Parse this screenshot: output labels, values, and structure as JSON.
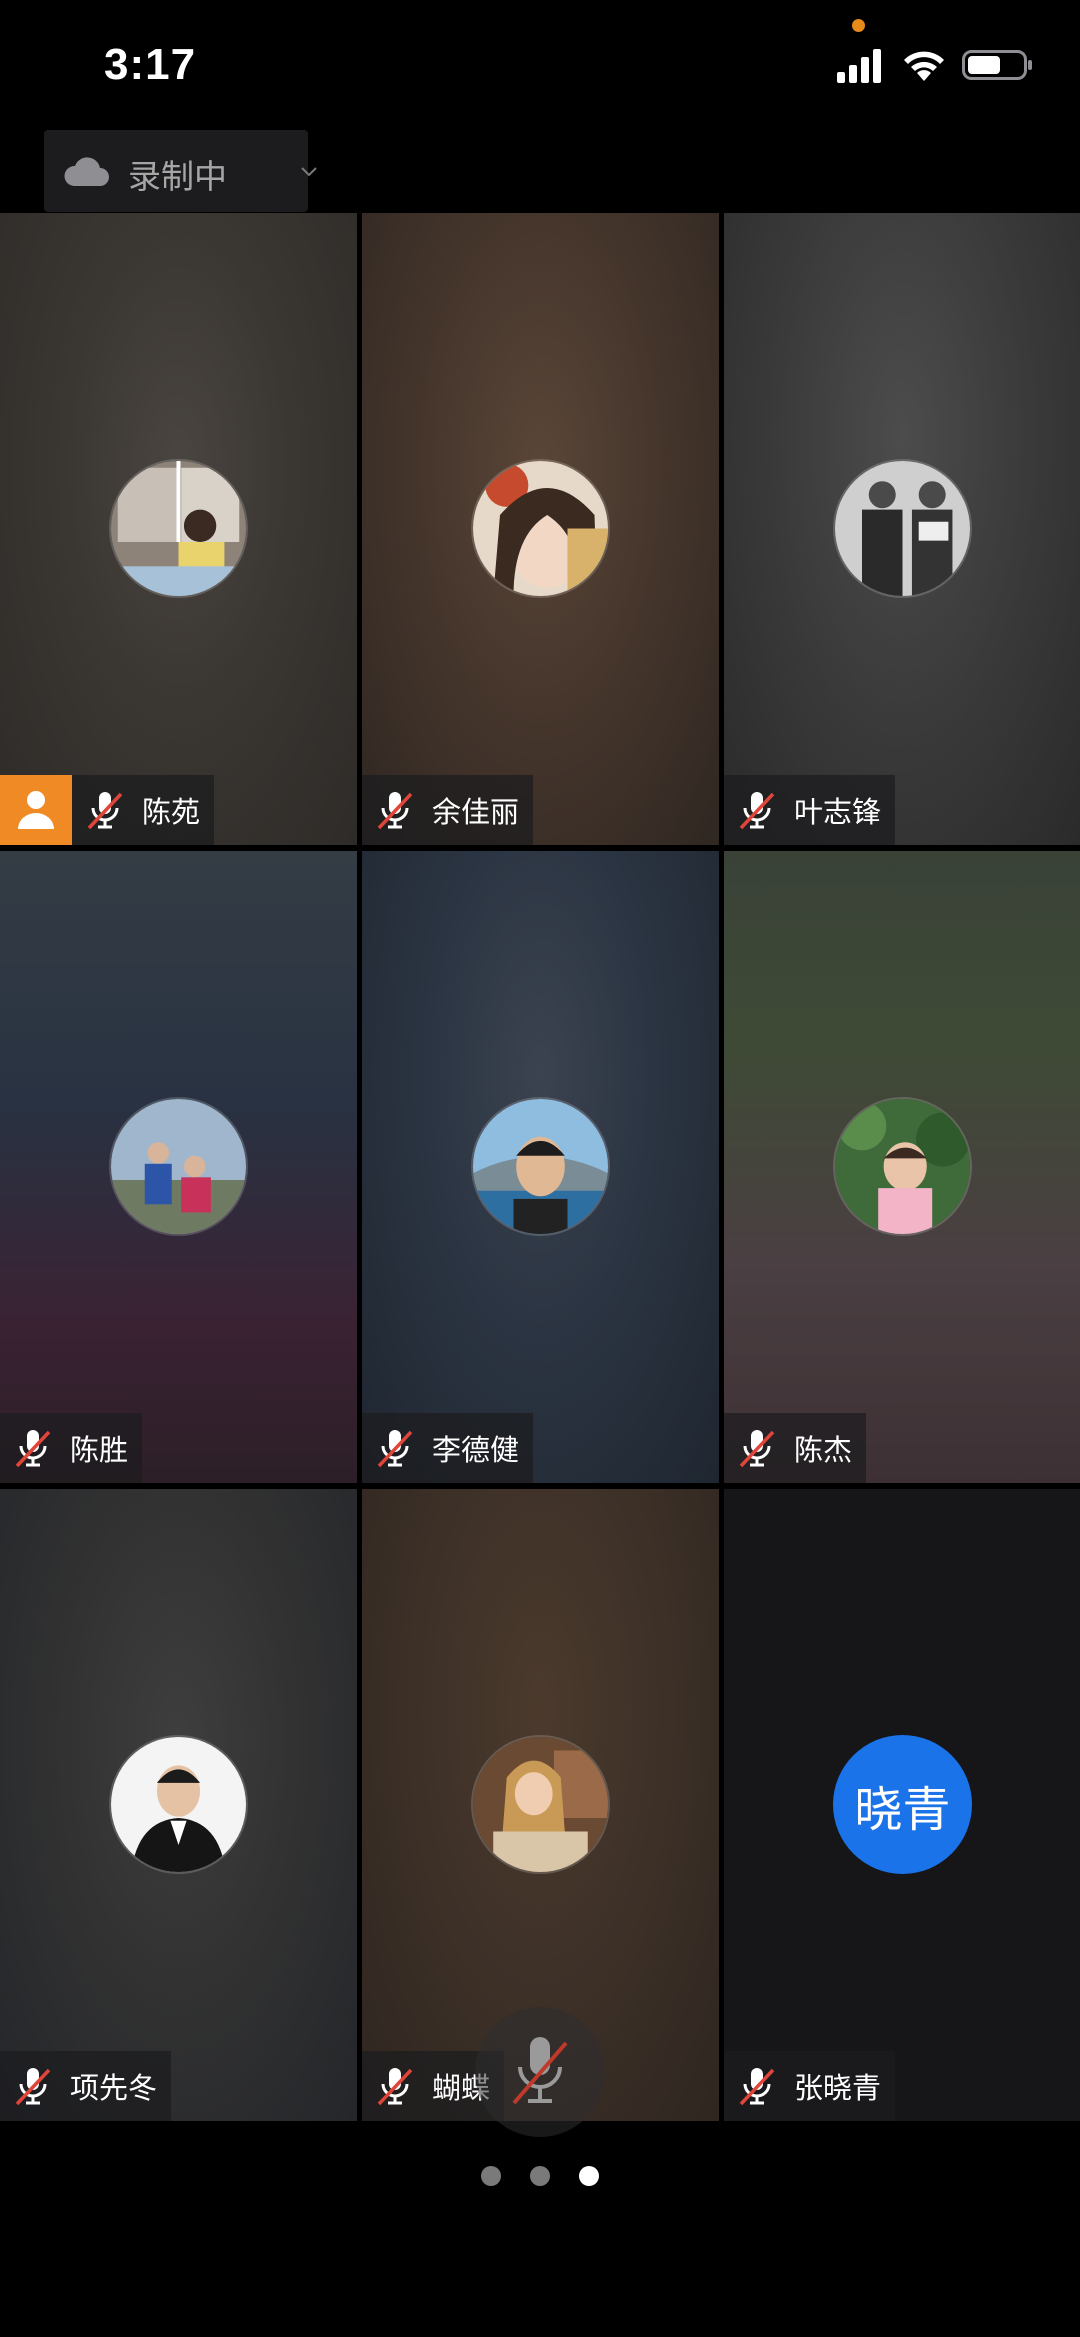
{
  "status_bar": {
    "time": "3:17",
    "signal_icon": "cellular-signal-icon",
    "wifi_icon": "wifi-icon",
    "battery_icon": "battery-icon",
    "recording_indicator_color": "#e68a1a"
  },
  "recording": {
    "label": "录制中",
    "icon": "cloud-icon",
    "dropdown_icon": "chevron-down-icon"
  },
  "participants": [
    {
      "name": "陈苑",
      "muted": true,
      "is_host": true,
      "avatar": "photo"
    },
    {
      "name": "余佳丽",
      "muted": true,
      "is_host": false,
      "avatar": "photo"
    },
    {
      "name": "叶志锋",
      "muted": true,
      "is_host": false,
      "avatar": "photo"
    },
    {
      "name": "陈胜",
      "muted": true,
      "is_host": false,
      "avatar": "photo"
    },
    {
      "name": "李德健",
      "muted": true,
      "is_host": false,
      "avatar": "photo"
    },
    {
      "name": "陈杰",
      "muted": true,
      "is_host": false,
      "avatar": "photo"
    },
    {
      "name": "项先冬",
      "muted": true,
      "is_host": false,
      "avatar": "photo"
    },
    {
      "name": "蝴蝶",
      "muted": true,
      "is_host": false,
      "avatar": "photo"
    },
    {
      "name": "张晓青",
      "muted": true,
      "is_host": false,
      "avatar": "initials",
      "initials": "晓青",
      "avatar_color": "#1a73e8"
    }
  ],
  "controls": {
    "mic_button_icon": "mic-off-icon"
  },
  "pagination": {
    "total": 3,
    "current": 3
  },
  "colors": {
    "host_badge": "#f08a24",
    "mute_slash": "#e0453a",
    "initials_avatar": "#1a73e8"
  }
}
